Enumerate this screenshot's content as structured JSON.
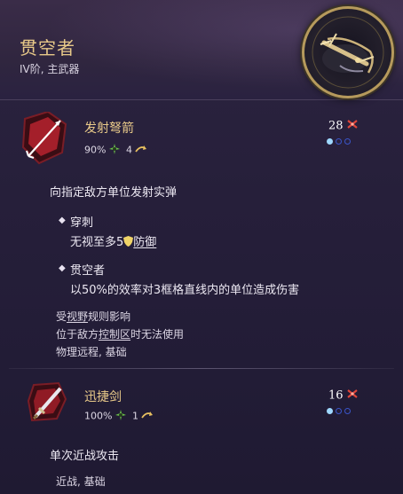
{
  "header": {
    "title": "贯空者",
    "subtitle": "IV阶, 主武器",
    "emblem_icon": "crossbow-emblem-icon"
  },
  "skills": [
    {
      "name": "发射弩箭",
      "accuracy": "90%",
      "range": "4",
      "cost": "28",
      "icon": "arrow-skill-icon",
      "description": "向指定敌方单位发射实弹",
      "traits": [
        {
          "name": "穿刺",
          "desc_pre": "无视至多5",
          "desc_link": "防御"
        },
        {
          "name": "贯空者",
          "desc": "以50%的效率对3框格直线内的单位造成伤害"
        }
      ],
      "notes": {
        "line1_pre": "受",
        "line1_link": "视野",
        "line1_post": "规则影响",
        "line2_pre": "位于敌方",
        "line2_link": "控制区",
        "line2_post": "时无法使用",
        "line3": "物理远程, 基础"
      }
    },
    {
      "name": "迅捷剑",
      "accuracy": "100%",
      "range": "1",
      "cost": "16",
      "icon": "sword-skill-icon",
      "description": "单次近战攻击",
      "tags": "近战, 基础"
    }
  ],
  "colors": {
    "gold": "#e8c989",
    "cost_icon": "#e0463a",
    "accuracy_icon": "#6cc24a",
    "range_icon": "#e8c060",
    "dot_active": "#9fd8ff",
    "dot_empty": "#3a55c8"
  }
}
